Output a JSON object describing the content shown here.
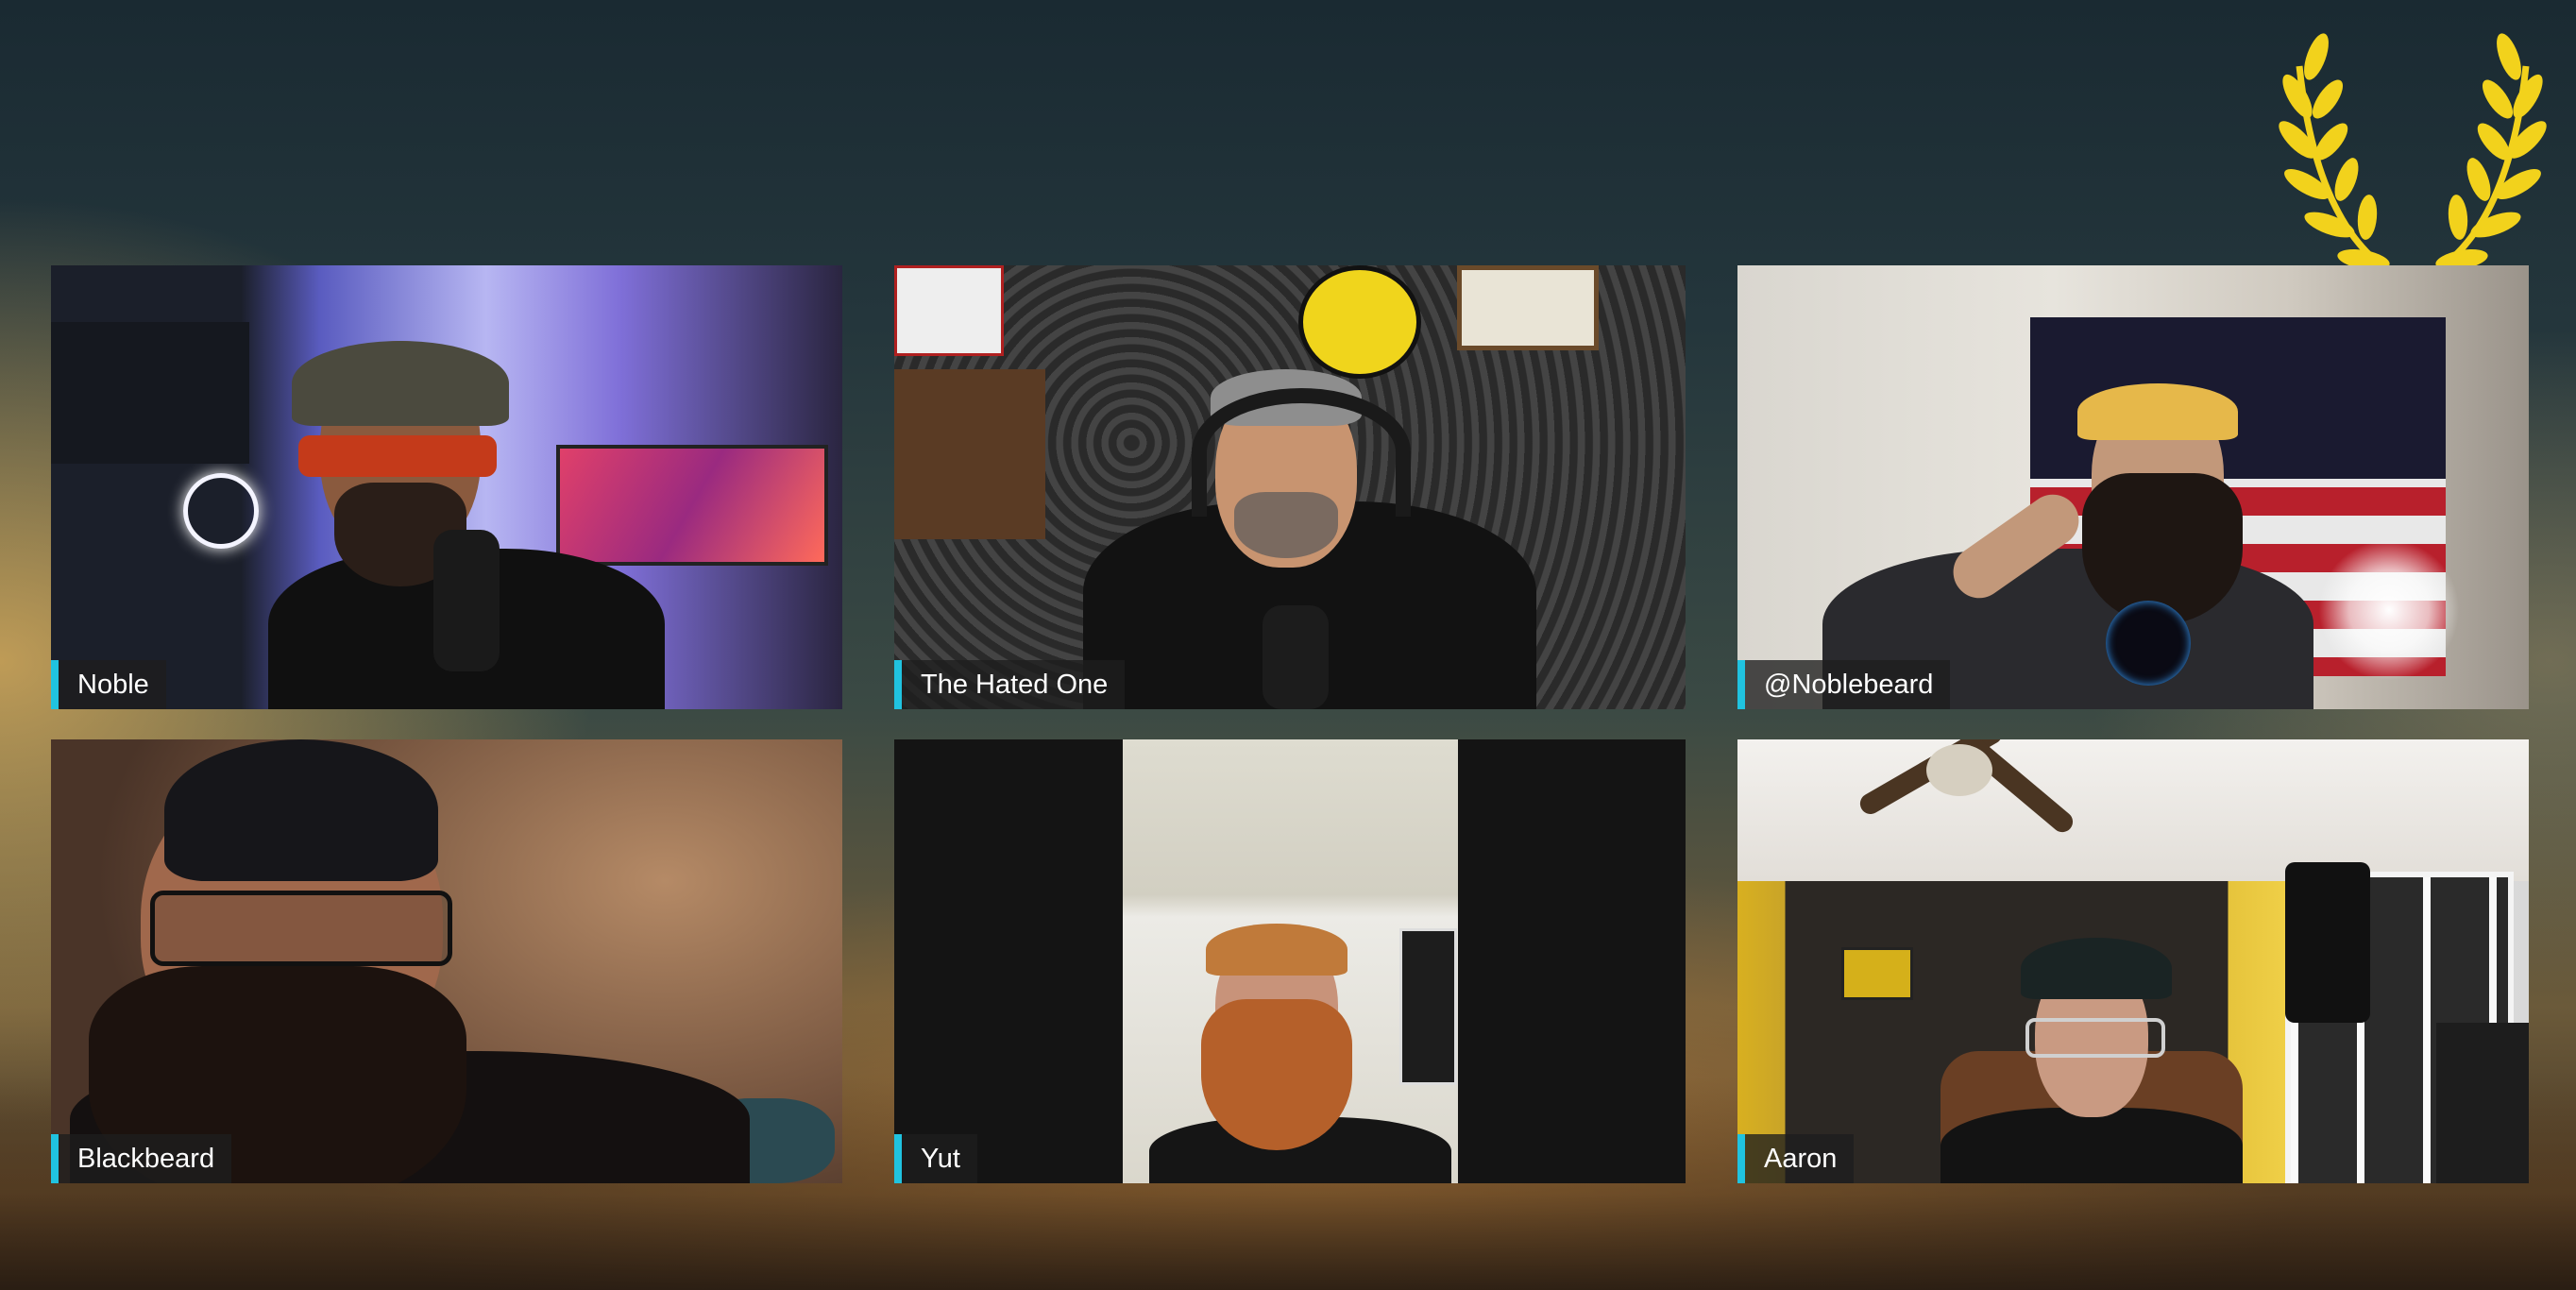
{
  "participants": [
    {
      "name": "Noble"
    },
    {
      "name": "The Hated One"
    },
    {
      "name": "@Noblebeard"
    },
    {
      "name": "Blackbeard"
    },
    {
      "name": "Yut"
    },
    {
      "name": "Aaron"
    }
  ],
  "colors": {
    "name_tag_accent": "#20c3e0",
    "laurel": "#f2d21c"
  },
  "icons": [
    "laurel-wreath-icon"
  ]
}
